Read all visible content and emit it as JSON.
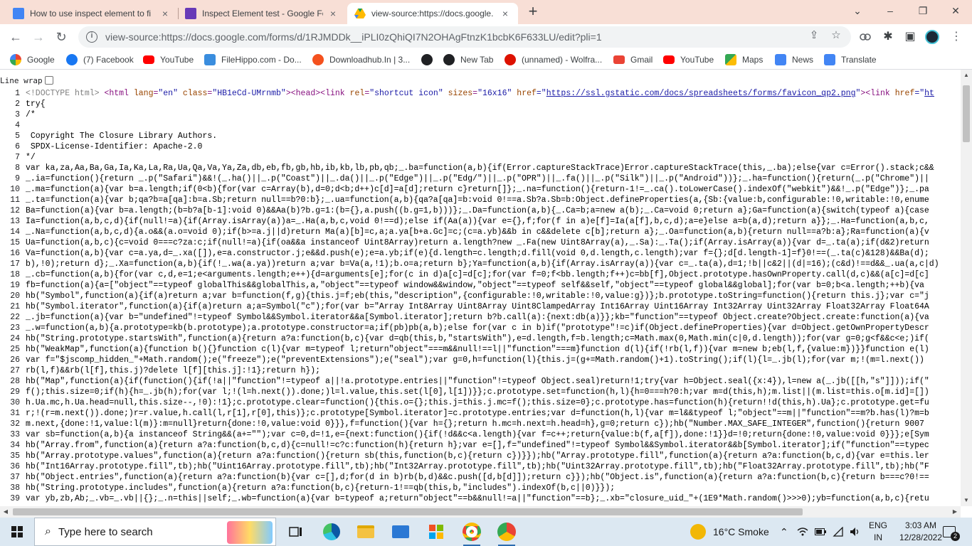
{
  "tabs": [
    {
      "title": "How to use inspect element to fi",
      "color": "#4285f4",
      "active": false
    },
    {
      "title": "Inspect Element test - Google Fo",
      "color": "#673ab7",
      "active": false
    },
    {
      "title": "view-source:https://docs.google.",
      "color": "#34a853",
      "active": true
    }
  ],
  "tab_close_glyph": "×",
  "new_tab_glyph": "+",
  "window_controls": {
    "dropdown": "⌄",
    "minimize": "–",
    "maximize": "❐",
    "close": "✕"
  },
  "toolbar": {
    "url": "view-source:https://docs.google.com/forms/d/1RJMDDk__iPLI0zQhiQI7N2OHAgFtnzK1bcbK6F633LU/edit?pli=1",
    "back_glyph": "←",
    "forward_glyph": "→",
    "reload_glyph": "↻",
    "info_glyph": "i",
    "share_glyph": "⇪",
    "star_glyph": "☆",
    "extension_glyph": "✱",
    "sidepanel_glyph": "▣"
  },
  "bookmarks": [
    {
      "label": "Google",
      "color": "#4285f4"
    },
    {
      "label": "(7) Facebook",
      "color": "#1877f2"
    },
    {
      "label": "YouTube",
      "color": "#ff0000"
    },
    {
      "label": "FileHippo.com - Do...",
      "color": "#3a8dde"
    },
    {
      "label": "Downloadhub.In | 3...",
      "color": "#f4511e"
    },
    {
      "label": "",
      "color": "#202124"
    },
    {
      "label": "New Tab",
      "color": "#202124"
    },
    {
      "label": "(unnamed) - Wolfra...",
      "color": "#dd1100"
    },
    {
      "label": "Gmail",
      "color": "#ea4335"
    },
    {
      "label": "YouTube",
      "color": "#ff0000"
    },
    {
      "label": "Maps",
      "color": "#34a853"
    },
    {
      "label": "News",
      "color": "#4285f4"
    },
    {
      "label": "Translate",
      "color": "#4285f4"
    }
  ],
  "line_wrap_label": "Line wrap",
  "source": {
    "l1": {
      "doctype": "<!DOCTYPE html>",
      "html_open": "<html ",
      "attr_lang": "lang",
      "eq_lang": "=",
      "val_lang": "\"en\"",
      "attr_class": " class",
      "eq_class": "=",
      "val_class": "\"HB1eCd-UMrnmb\"",
      "html_close": ">",
      "head": "<head>",
      "link_open": "<link ",
      "attr_rel": "rel",
      "eq_rel": "=",
      "val_rel": "\"shortcut icon\"",
      "attr_sizes": " sizes",
      "eq_sizes": "=",
      "val_sizes": "\"16x16\"",
      "attr_href": " href",
      "eq_href": "=\"",
      "href_link": "https://ssl.gstatic.com/docs/spreadsheets/forms/favicon_qp2.png",
      "href_close": "\"",
      "link_close": ">",
      "link2": "<link ",
      "attr_href2": "href",
      "eq_href2": "=\"",
      "href2_link": "ht"
    },
    "lines": [
      "try{",
      "/*",
      "",
      " Copyright The Closure Library Authors.",
      " SPDX-License-Identifier: Apache-2.0",
      "*/",
      "var ka,za,Aa,Ba,Ga,Ia,Ka,La,Ra,Ua,Qa,Va,Ya,Za,db,eb,fb,gb,hb,ib,kb,lb,pb,qb;_.ba=function(a,b){if(Error.captureStackTrace)Error.captureStackTrace(this,_.ba);else{var c=Error().stack;c&&",
      "_.ia=function(){return _.p(\"Safari\")&&!(_.ha()||_.p(\"Coast\")||_.da()||_.p(\"Edge\")||_.p(\"Edg/\")||_.p(\"OPR\")||_.fa()||_.p(\"Silk\")||_.p(\"Android\"))};_.ha=function(){return(_.p(\"Chrome\")||",
      "_.ma=function(a){var b=a.length;if(0<b){for(var c=Array(b),d=0;d<b;d++)c[d]=a[d];return c}return[]};_.na=function(){return-1!=_.ca().toLowerCase().indexOf(\"webkit\")&&!_.p(\"Edge\")};_.pa",
      "_.ta=function(a){var b;qa?b=a[qa]:b=a.Sb;return null==b?0:b};_.ua=function(a,b){qa?a[qa]=b:void 0!==a.Sb?a.Sb=b:Object.defineProperties(a,{Sb:{value:b,configurable:!0,writable:!0,enume",
      "Ba=function(a){var b=a.length;(b=b?a[b-1]:void 0)&&Aa(b)?b.g=1:(b={},a.push((b.g=1,b)))};_.Da=function(a,b){_.Ca=b;a=new a(b);_.Ca=void 0;return a};Ga=function(a){switch(typeof a){case",
      "Ia=function(a,b,c,d){if(null!=a){if(Array.isArray(a))a=_.Ha(a,b,c,void 0!==d);else if(Aa(a)){var e={},f;for(f in a)e[f]=Ia(a[f],b,c,d);a=e}else a=b(a,d);return a}};_.Ha=function(a,b,c,",
      "_.Na=function(a,b,c,d){a.o&&(a.o=void 0);if(b>=a.j||d)return Ma(a)[b]=c,a;a.ya[b+a.Gc]=c;(c=a.yb)&&b in c&&delete c[b];return a};_.Oa=function(a,b){return null==a?b:a};Ra=function(a){v",
      "Ua=function(a,b,c){c=void 0===c?za:c;if(null!=a){if(oa&&a instanceof Uint8Array)return a.length?new _.Fa(new Uint8Array(a),_.Sa):_.Ta();if(Array.isArray(a)){var d=_.ta(a);if(d&2)return",
      "Va=function(a,b){var c=a.ya,d=_.xa([]),e=a.constructor.j;e&&d.push(e);e=a.yb;if(e){d.length=c.length;d.fill(void 0,d.length,c.length);var f={};d[d.length-1]=f}0!==(_.ta(c)&128)&&Ba(d);",
      "b),!0);return d};_.Xa=function(a,b){if(!_.wa(a.ya))return a;var b=Va(a,!1);b.o=a;return b};Ya=function(a,b){if(Array.isArray(a)){var c=_.ta(a),d=1;!b||c&2||(d|=16);(c&d)!==d&&_.ua(a,c|d)",
      "_.cb=function(a,b){for(var c,d,e=1;e<arguments.length;e++){d=arguments[e];for(c in d)a[c]=d[c];for(var f=0;f<bb.length;f++)c=bb[f],Object.prototype.hasOwnProperty.call(d,c)&&(a[c]=d[c]",
      "fb=function(a){a=[\"object\"==typeof globalThis&&globalThis,a,\"object\"==typeof window&&window,\"object\"==typeof self&&self,\"object\"==typeof global&&global];for(var b=0;b<a.length;++b){va",
      "hb(\"Symbol\",function(a){if(a)return a;var b=function(f,g){this.j=f;eb(this,\"description\",{configurable:!0,writable:!0,value:g})};b.prototype.toString=function(){return this.j};var c=\"j",
      "hb(\"Symbol.iterator\",function(a){if(a)return a;a=Symbol(\"c\");for(var b=\"Array Int8Array Uint8Array Uint8ClampedArray Int16Array Uint16Array Int32Array Uint32Array Float32Array Float64A",
      "_.jb=function(a){var b=\"undefined\"!=typeof Symbol&&Symbol.iterator&&a[Symbol.iterator];return b?b.call(a):{next:db(a)}};kb=\"function\"==typeof Object.create?Object.create:function(a){va",
      "_.w=function(a,b){a.prototype=kb(b.prototype);a.prototype.constructor=a;if(pb)pb(a,b);else for(var c in b)if(\"prototype\"!=c)if(Object.defineProperties){var d=Object.getOwnPropertyDescr",
      "hb(\"String.prototype.startsWith\",function(a){return a?a:function(b,c){var d=qb(this,b,\"startsWith\"),e=d.length,f=b.length;c=Math.max(0,Math.min(c|0,d.length));for(var g=0;g<f&&c<e;)if(",
      "hb(\"WeakMap\",function(a){function b(){}function c(l){var m=typeof l;return\"object\"===m&&null!==l||\"function\"===m}function d(l){if(!rb(l,f)){var m=new b;eb(l,f,{value:m})}}function e(l)",
      "var f=\"$jscomp_hidden_\"+Math.random();e(\"freeze\");e(\"preventExtensions\");e(\"seal\");var g=0,h=function(l){this.j=(g+=Math.random()+1).toString();if(l){l=_.jb(l);for(var m;!(m=l.next())",
      "rb(l,f)&&rb(l[f],this.j)?delete l[f][this.j]:!1};return h});",
      "hb(\"Map\",function(a){if(function(){if(!a||\"function\"!=typeof a||!a.prototype.entries||\"function\"!=typeof Object.seal)return!1;try{var h=Object.seal({x:4}),l=new a(_.jb([[h,\"s\"]]));if(\"",
      "f();this.size=0;if(h){h=_.jb(h);for(var l;!(l=h.next()).done;)l=l.value,this.set(l[0],l[1])}};c.prototype.set=function(h,l){h=0===h?0:h;var m=d(this,h);m.list||(m.list=this.o[m.id]=[])",
      "h.Ua.mc,h.Ua.head=null,this.size--,!0):!1};c.prototype.clear=function(){this.o={};this.j=this.j.mc=f();this.size=0};c.prototype.has=function(h){return!!d(this,h).Ua};c.prototype.get=fu",
      "r;!(r=m.next()).done;)r=r.value,h.call(l,r[1],r[0],this)};c.prototype[Symbol.iterator]=c.prototype.entries;var d=function(h,l){var m=l&&typeof l;\"object\"==m||\"function\"==m?b.has(l)?m=b",
      "m.next,{done:!1,value:l(m)}:m=null}return{done:!0,value:void 0}}},f=function(){var h={};return h.mc=h.next=h.head=h},g=0;return c});hb(\"Number.MAX_SAFE_INTEGER\",function(){return 9007",
      "var sb=function(a,b){a instanceof String&&(a+=\"\");var c=0,d=!1,e={next:function(){if(!d&&c<a.length){var f=c++;return{value:b(f,a[f]),done:!1}}d=!0;return{done:!0,value:void 0}}};e[Sym",
      "hb(\"Array.from\",function(a){return a?a:function(b,c,d){c=null!=c?c:function(h){return h};var e=[],f=\"undefined\"!=typeof Symbol&&Symbol.iterator&&b[Symbol.iterator];if(\"function\"==typec",
      "hb(\"Array.prototype.values\",function(a){return a?a:function(){return sb(this,function(b,c){return c})}});hb(\"Array.prototype.fill\",function(a){return a?a:function(b,c,d){var e=this.ler",
      "hb(\"Int16Array.prototype.fill\",tb);hb(\"Uint16Array.prototype.fill\",tb);hb(\"Int32Array.prototype.fill\",tb);hb(\"Uint32Array.prototype.fill\",tb);hb(\"Float32Array.prototype.fill\",tb);hb(\"F",
      "hb(\"Object.entries\",function(a){return a?a:function(b){var c=[],d;for(d in b)rb(b,d)&&c.push([d,b[d]]);return c}});hb(\"Object.is\",function(a){return a?a:function(b,c){return b===c?0!==",
      "hb(\"String.prototype.includes\",function(a){return a?a:function(b,c){return-1!==qb(this,b,\"includes\").indexOf(b,c||0)}});",
      "var yb,zb,Ab;_.vb=_.vb||{};_.n=this||self;_.wb=function(a){var b=typeof a;return\"object\"==b&&null!=a||\"function\"==b};_.xb=\"closure_uid_\"+(1E9*Math.random()>>>0);yb=function(a,b,c){retu"
    ]
  },
  "taskbar": {
    "search_placeholder": "Type here to search",
    "search_glyph": "⌕",
    "weather": "16°C  Smoke",
    "lang_top": "ENG",
    "lang_bottom": "IN",
    "time": "3:03 AM",
    "date": "12/28/2022",
    "tray_up_glyph": "⌃",
    "notification_glyph": "2"
  }
}
